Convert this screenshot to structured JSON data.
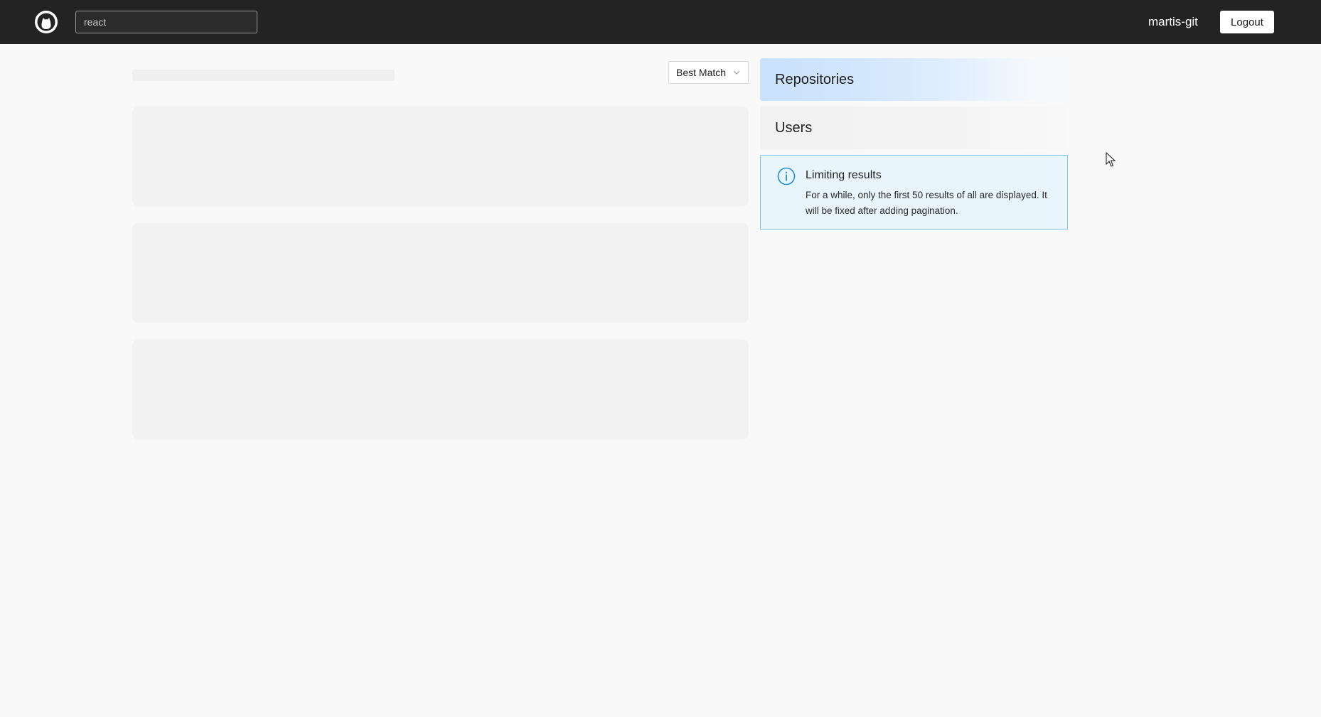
{
  "header": {
    "logo_icon": "octocat-logo-icon",
    "search_value": "react",
    "username": "martis-git",
    "logout_label": "Logout"
  },
  "main": {
    "sort": {
      "selected": "Best Match",
      "icon": "chevron-down-icon"
    },
    "loading_cards": 3
  },
  "sidebar": {
    "tabs": [
      {
        "label": "Repositories",
        "active": true
      },
      {
        "label": "Users",
        "active": false
      }
    ],
    "notice": {
      "icon": "info-icon",
      "title": "Limiting results",
      "text": "For a while, only the first 50 results of all are displayed. It will be fixed after adding pagination."
    }
  },
  "colors": {
    "header_bg": "#232323",
    "page_bg": "#f9f9f9",
    "active_tab": "#c9e1fb",
    "notice_bg": "#e8f5fd",
    "notice_border": "#85c6f0",
    "info_accent": "#1a8fdc"
  }
}
